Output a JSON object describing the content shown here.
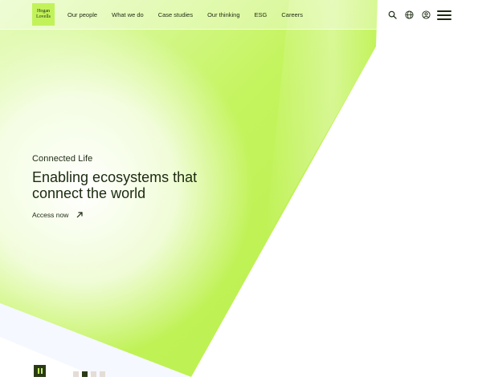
{
  "header": {
    "logo": {
      "line1": "Hogan",
      "line2": "Lovells"
    },
    "nav": [
      {
        "label": "Our people"
      },
      {
        "label": "What we do"
      },
      {
        "label": "Case studies"
      },
      {
        "label": "Our thinking"
      },
      {
        "label": "ESG"
      },
      {
        "label": "Careers"
      }
    ],
    "icons": [
      "search-icon",
      "globe-icon",
      "user-account-icon",
      "hamburger-menu-icon"
    ]
  },
  "hero": {
    "eyebrow": "Connected Life",
    "headline_line1": "Enabling ecosystems that",
    "headline_line2": "connect the world",
    "cta_label": "Access now",
    "cta_icon": "arrow-up-right-icon"
  },
  "carousel": {
    "pause_icon": "pause-icon",
    "slide_count": 4,
    "active_slide": 2
  },
  "colors": {
    "brand_green": "#c2f25a",
    "dark_green": "#2a3a16",
    "text": "#1b2a10",
    "inactive_dot": "#e4dcd6"
  }
}
